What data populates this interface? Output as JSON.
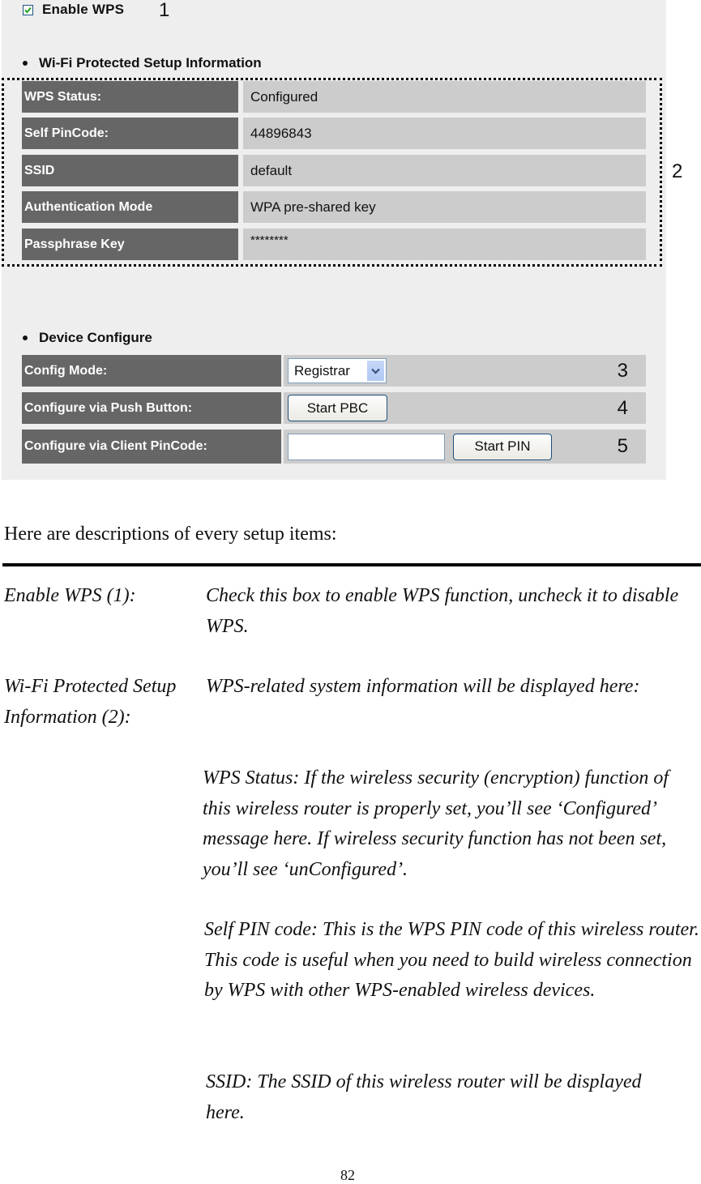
{
  "screenshot": {
    "enable_wps": {
      "label": "Enable WPS",
      "checked": true
    },
    "callouts": {
      "c1": "1",
      "c2": "2",
      "c3": "3",
      "c4": "4",
      "c5": "5"
    },
    "wps_info": {
      "title": "Wi-Fi Protected Setup Information",
      "rows": [
        {
          "label": "WPS Status:",
          "value": "Configured"
        },
        {
          "label": "Self PinCode:",
          "value": "44896843"
        },
        {
          "label": "SSID",
          "value": "default"
        },
        {
          "label": "Authentication Mode",
          "value": "WPA pre-shared key"
        },
        {
          "label": "Passphrase Key",
          "value": "********"
        }
      ]
    },
    "device_configure": {
      "title": "Device Configure",
      "config_mode": {
        "label": "Config Mode:",
        "selected": "Registrar"
      },
      "push_button": {
        "label": "Configure via Push Button:",
        "button": "Start PBC"
      },
      "client_pin": {
        "label": "Configure via Client PinCode:",
        "value": "",
        "button": "Start PIN"
      }
    }
  },
  "document": {
    "intro": "Here are descriptions of every setup items:",
    "items": [
      {
        "term": "Enable WPS (1):",
        "paragraphs": [
          "Check this box to enable WPS function, uncheck it to disable WPS."
        ]
      },
      {
        "term": "Wi-Fi Protected Setup Information (2):",
        "paragraphs": [
          "WPS-related system information will be displayed here:",
          "WPS Status: If the wireless security (encryption) function of this wireless router is properly set, you’ll see ‘Configured’ message here. If wireless security function has not been set, you’ll see ‘unConfigured’.",
          "Self PIN code: This is the WPS PIN code of this wireless router. This code is useful when you need to build wireless connection by WPS with other WPS-enabled wireless devices.",
          "SSID: The SSID of this wireless router will be displayed here."
        ]
      }
    ],
    "page_number": "82"
  }
}
